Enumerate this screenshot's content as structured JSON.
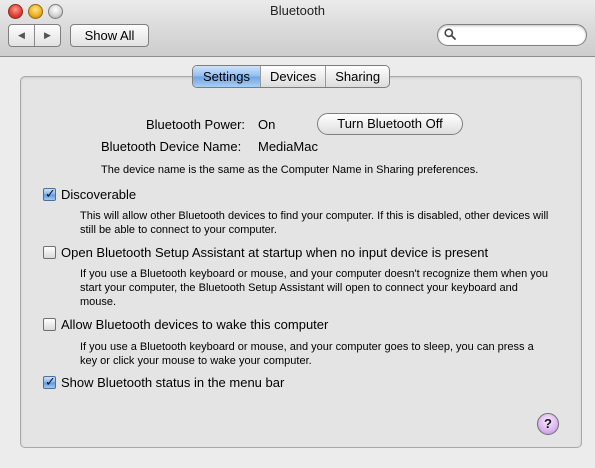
{
  "window": {
    "title": "Bluetooth"
  },
  "toolbar": {
    "back_icon": "left-arrow",
    "forward_icon": "right-arrow",
    "show_all_label": "Show All",
    "search_placeholder": "",
    "search_value": ""
  },
  "tabs": [
    {
      "label": "Settings",
      "active": true
    },
    {
      "label": "Devices",
      "active": false
    },
    {
      "label": "Sharing",
      "active": false
    }
  ],
  "settings": {
    "power_label": "Bluetooth Power:",
    "power_value": "On",
    "turn_off_button": "Turn Bluetooth Off",
    "device_name_label": "Bluetooth Device Name:",
    "device_name_value": "MediaMac",
    "device_name_note": "The device name is the same as the Computer Name in Sharing preferences.",
    "options": [
      {
        "label": "Discoverable",
        "checked": true,
        "description": "This will allow other Bluetooth devices to find your computer.  If this is disabled, other devices will still be able to connect to your computer."
      },
      {
        "label": "Open Bluetooth Setup Assistant at startup when no input device is present",
        "checked": false,
        "description": "If you use a Bluetooth keyboard or mouse, and your computer doesn't recognize them when you start your computer, the Bluetooth Setup Assistant will open to connect your keyboard and mouse."
      },
      {
        "label": "Allow Bluetooth devices to wake this computer",
        "checked": false,
        "description": "If you use a Bluetooth keyboard or mouse, and your computer goes to sleep, you can press a key or click your mouse to wake your computer."
      },
      {
        "label": "Show Bluetooth status in the menu bar",
        "checked": true,
        "description": ""
      }
    ],
    "help_button": "?"
  }
}
